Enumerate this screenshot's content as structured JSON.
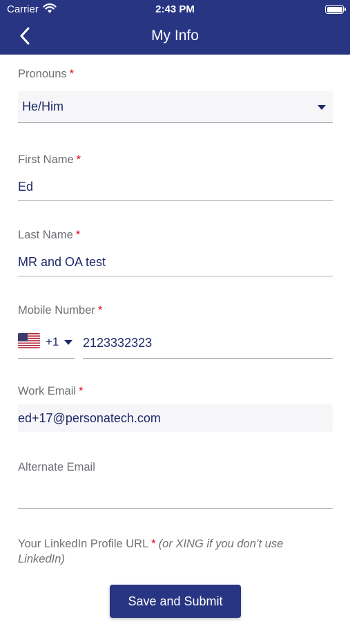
{
  "status_bar": {
    "carrier": "Carrier",
    "time": "2:43 PM"
  },
  "header": {
    "title": "My Info",
    "back_icon": "chevron-left-icon"
  },
  "form": {
    "required_marker": "*",
    "pronouns": {
      "label": "Pronouns",
      "value": "He/Him"
    },
    "first_name": {
      "label": "First Name",
      "value": "Ed"
    },
    "last_name": {
      "label": "Last Name",
      "value": "MR and OA test"
    },
    "mobile_number": {
      "label": "Mobile Number",
      "country_flag": "us-flag-icon",
      "country_code": "+1",
      "value": "2123332323"
    },
    "work_email": {
      "label": "Work Email",
      "value": "ed+17@personatech.com"
    },
    "alternate_email": {
      "label": "Alternate Email",
      "value": ""
    },
    "linkedin": {
      "label": "Your LinkedIn Profile URL",
      "hint": "(or XING if you don’t use LinkedIn)",
      "value": ""
    }
  },
  "footer": {
    "save_button": "Save and Submit"
  },
  "colors": {
    "header_bg": "#283583",
    "button_bg": "#283583",
    "required": "#e3001b",
    "text": "#1f2a6b",
    "label": "#6f7076"
  }
}
